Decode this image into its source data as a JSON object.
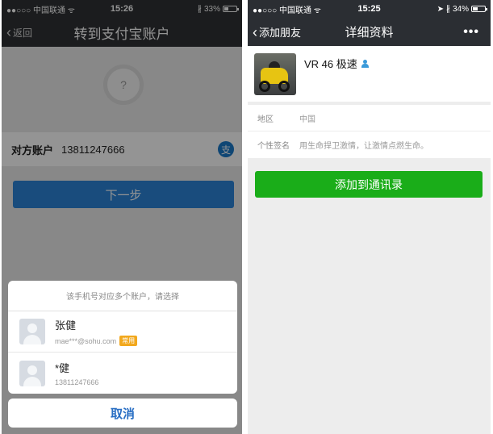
{
  "left_screen": {
    "status": {
      "carrier": "●●○○○ 中国联通 ᯤ",
      "time": "15:26",
      "battery": "33%",
      "battery_level": 0.33
    },
    "nav": {
      "back_label": "返回",
      "title": "转到支付宝账户"
    },
    "account": {
      "label": "对方账户",
      "value": "13811247666",
      "alipay_badge": "支"
    },
    "next_button": "下一步",
    "sheet": {
      "prompt": "该手机号对应多个账户，请选择",
      "options": [
        {
          "name": "张健",
          "detail": "mae***@sohu.com",
          "tag": "常用"
        },
        {
          "name": "*健",
          "detail": "13811247666"
        }
      ],
      "cancel": "取消"
    },
    "colors": {
      "nav_bg": "#2f3134",
      "next_button": "#2c84d8",
      "cancel_text": "#2a6fc4",
      "tag": "#f2a81d"
    }
  },
  "right_screen": {
    "status": {
      "carrier": "●●○○○ 中国联通 ᯤ",
      "time": "15:25",
      "battery": "34%",
      "battery_level": 0.34
    },
    "nav": {
      "back_label": "添加朋友",
      "title": "详细资料",
      "more": "•••"
    },
    "profile": {
      "name": "VR 46 极速"
    },
    "info": [
      {
        "label": "地区",
        "value": "中国"
      },
      {
        "label": "个性签名",
        "value": "用生命捍卫激情，让激情点燃生命。"
      }
    ],
    "add_button": "添加到通讯录",
    "colors": {
      "nav_bg": "#2b2e33",
      "add_button": "#1aad19"
    }
  }
}
